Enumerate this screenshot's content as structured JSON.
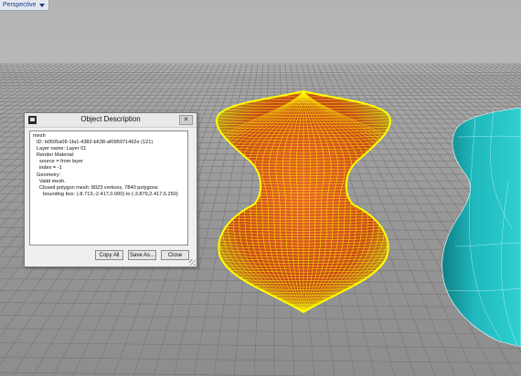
{
  "viewport": {
    "label": "Perspective",
    "menu_icon": "chevron-down-icon"
  },
  "dialog": {
    "title": "Object Description",
    "icon": "app-icon",
    "close_label": "✕",
    "lines": [
      "mesh",
      "ID: b0505a09-1fa1-4382-b638-af095971492e (121)",
      "Layer name: Layer 01",
      "Render Material:",
      "source = from layer",
      "index = -1",
      "Geometry:",
      "Valid mesh.",
      "Closed polygon mesh: 8023 vertices, 7840 polygons",
      "bounding box: (-8.713,-2.417,0.000) to (-3.879,2.417,6.250)"
    ],
    "buttons": {
      "copy_all": "Copy All",
      "save_as": "Save As...",
      "close": "Close"
    }
  },
  "colors": {
    "wire": "#ffff00",
    "surface": "#d0551e",
    "teal": "#1ab6b6"
  }
}
